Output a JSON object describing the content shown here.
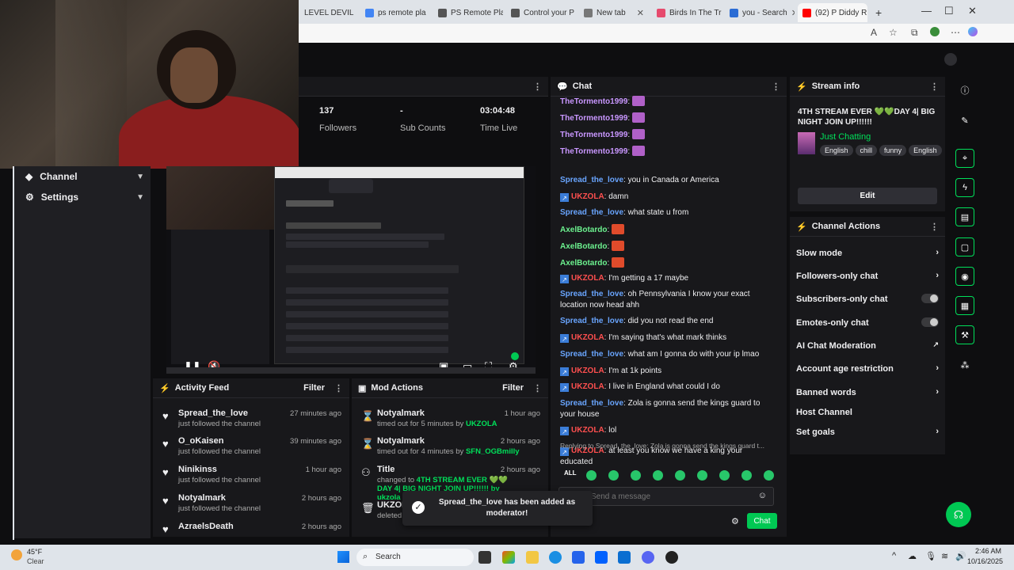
{
  "browser": {
    "tabs": [
      {
        "title": "LEVEL DEVIL -",
        "color": "#5b5b5b"
      },
      {
        "title": "ps remote pla",
        "color": "#4285f4"
      },
      {
        "title": "PS Remote Pla",
        "color": "#555555"
      },
      {
        "title": "Control your P",
        "color": "#555555"
      },
      {
        "title": "New tab",
        "color": "#777777"
      },
      {
        "title": "Birds In The Tr",
        "color": "#e64a6d"
      },
      {
        "title": "you - Search",
        "color": "#2b6cd4"
      },
      {
        "title": "(92) P Diddy R",
        "color": "#ff0000"
      }
    ]
  },
  "stats": {
    "followers_value": "137",
    "followers_label": "Followers",
    "subs_value": "-",
    "subs_label": "Sub Counts",
    "time_value": "03:04:48",
    "time_label": "Time Live"
  },
  "sidebar": {
    "channel": "Channel",
    "settings": "Settings"
  },
  "activity_feed": {
    "title": "Activity Feed",
    "filter": "Filter",
    "items": [
      {
        "name": "Spread_the_love",
        "sub": "just followed the channel",
        "time": "27 minutes ago"
      },
      {
        "name": "O_oKaisen",
        "sub": "just followed the channel",
        "time": "39 minutes ago"
      },
      {
        "name": "Ninikinss",
        "sub": "just followed the channel",
        "time": "1 hour ago"
      },
      {
        "name": "Notyalmark",
        "sub": "just followed the channel",
        "time": "2 hours ago"
      },
      {
        "name": "AzraelsDeath",
        "sub": "",
        "time": "2 hours ago"
      }
    ]
  },
  "mod_actions": {
    "title": "Mod Actions",
    "filter": "Filter",
    "items": [
      {
        "name": "Notyalmark",
        "sub": "timed out for 5 minutes by",
        "by": "UKZOLA",
        "time": "1 hour ago"
      },
      {
        "name": "Notyalmark",
        "sub": "timed out for 4 minutes by",
        "by": "SFN_OGBmilly",
        "time": "2 hours ago"
      },
      {
        "name": "Title",
        "sub": "changed to",
        "by": "4TH STREAM EVER 💚💚DAY 4| BIG NIGHT JOIN UP!!!!!! by ukzola",
        "time": "2 hours ago"
      },
      {
        "name": "UKZOLA",
        "sub": "deleted a",
        "by": "",
        "time": ""
      }
    ]
  },
  "chat": {
    "title": "Chat",
    "placeholder": "Send a message",
    "send": "Chat",
    "reply_note": "Replying to Spread_the_love: Zola is gonna send the kings guard t...",
    "messages": [
      {
        "user": "TheTormento1999",
        "text": "",
        "color": "purple"
      },
      {
        "user": "TheTormento1999",
        "text": "",
        "color": "purple"
      },
      {
        "user": "TheTormento1999",
        "text": "",
        "color": "purple"
      },
      {
        "user": "TheTormento1999",
        "text": "",
        "color": "purple"
      },
      {
        "user": "Spread_the_love",
        "text": "you in Canada or America",
        "color": "blue"
      },
      {
        "user": "UKZOLA",
        "text": "damn",
        "color": "red"
      },
      {
        "user": "Spread_the_love",
        "text": "what state u from",
        "color": "blue"
      },
      {
        "user": "AxelBotardo",
        "text": "",
        "color": "green"
      },
      {
        "user": "AxelBotardo",
        "text": "",
        "color": "green"
      },
      {
        "user": "AxelBotardo",
        "text": "",
        "color": "green"
      },
      {
        "user": "UKZOLA",
        "text": "I'm getting a 17 maybe",
        "color": "red"
      },
      {
        "user": "Spread_the_love",
        "text": "oh Pennsylvania I know your exact location now head ahh",
        "color": "blue"
      },
      {
        "user": "Spread_the_love",
        "text": "did you not read the end",
        "color": "blue"
      },
      {
        "user": "UKZOLA",
        "text": "I'm saying that's what mark thinks",
        "color": "red"
      },
      {
        "user": "Spread_the_love",
        "text": "what am I gonna do with your ip lmao",
        "color": "blue"
      },
      {
        "user": "UKZOLA",
        "text": "I'm at 1k points",
        "color": "red"
      },
      {
        "user": "UKZOLA",
        "text": "I live in England what could I do",
        "color": "red"
      },
      {
        "user": "Spread_the_love",
        "text": "Zola is gonna send the kings guard to your house",
        "color": "blue"
      },
      {
        "user": "UKZOLA",
        "text": "lol",
        "color": "red"
      },
      {
        "user": "UKZOLA",
        "text": "at least you know we have a king your educated",
        "color": "red"
      }
    ]
  },
  "stream_info": {
    "title": "Stream info",
    "stream_title": "4TH STREAM EVER 💚💚DAY 4| BIG NIGHT JOIN UP!!!!!!",
    "category": "Just Chatting",
    "tags": [
      "English",
      "chill",
      "funny",
      "English"
    ],
    "edit": "Edit"
  },
  "channel_actions": {
    "title": "Channel Actions",
    "items": [
      "Slow mode",
      "Followers-only chat",
      "Subscribers-only chat",
      "Emotes-only chat",
      "AI Chat Moderation",
      "Account age restriction",
      "Banned words",
      "Host Channel",
      "Set goals"
    ]
  },
  "toast": {
    "text": "Spread_the_love has been added as moderator!"
  },
  "taskbar": {
    "weather_temp": "45°F",
    "weather_desc": "Clear",
    "search": "Search",
    "time": "2:46 AM",
    "date": "10/16/2025"
  },
  "colors": {
    "accent": "#00e05a",
    "twitch_purple": "#9146ff",
    "green_btn": "#00c853"
  }
}
